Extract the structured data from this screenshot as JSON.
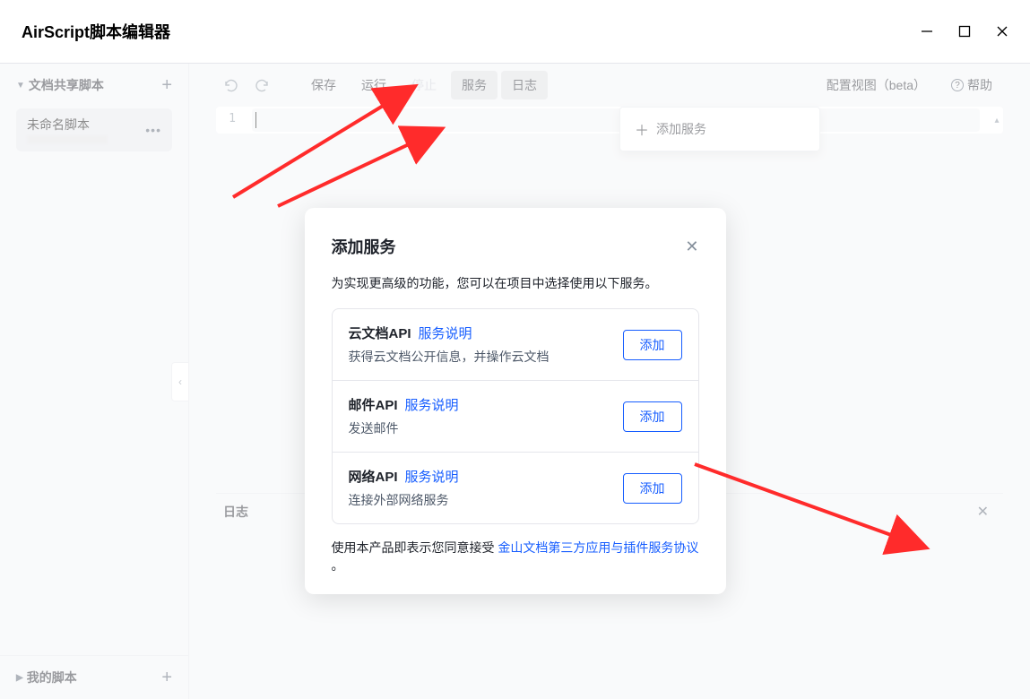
{
  "app": {
    "title": "AirScript脚本编辑器"
  },
  "sidebar": {
    "shared_title": "文档共享脚本",
    "my_title": "我的脚本",
    "script": {
      "name": "未命名脚本"
    }
  },
  "toolbar": {
    "save": "保存",
    "run": "运行",
    "stop": "停止",
    "service": "服务",
    "log": "日志",
    "config_view": "配置视图（beta）",
    "help": "帮助"
  },
  "editor": {
    "line1": "1"
  },
  "dropdown": {
    "add_service": "添加服务"
  },
  "log": {
    "title": "日志"
  },
  "modal": {
    "title": "添加服务",
    "desc": "为实现更高级的功能，您可以在项目中选择使用以下服务。",
    "services": [
      {
        "name": "云文档API",
        "link": "服务说明",
        "desc": "获得云文档公开信息，并操作云文档",
        "btn": "添加"
      },
      {
        "name": "邮件API",
        "link": "服务说明",
        "desc": "发送邮件",
        "btn": "添加"
      },
      {
        "name": "网络API",
        "link": "服务说明",
        "desc": "连接外部网络服务",
        "btn": "添加"
      }
    ],
    "footer_prefix": "使用本产品即表示您同意接受 ",
    "footer_link": "金山文档第三方应用与插件服务协议",
    "footer_suffix": " 。"
  }
}
